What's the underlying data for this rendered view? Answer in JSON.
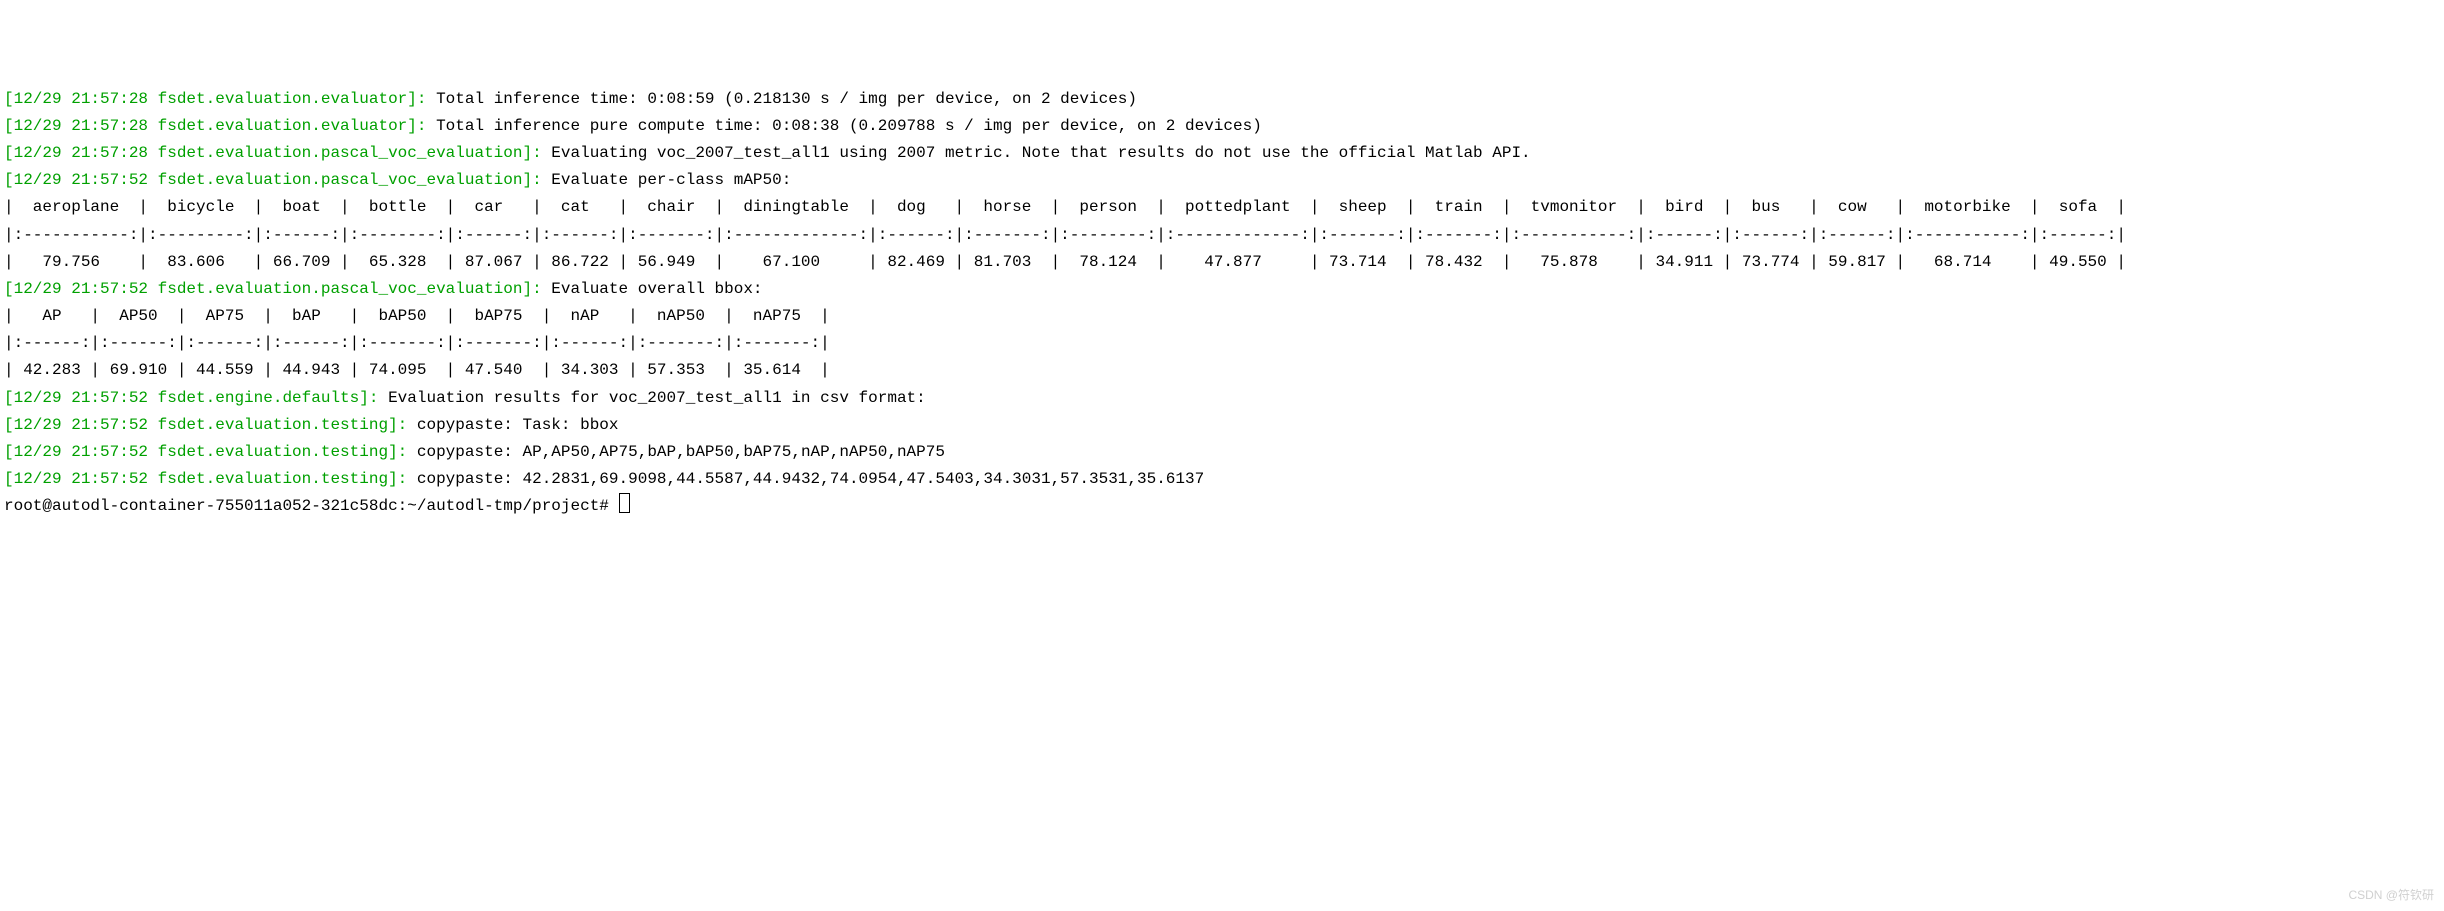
{
  "lines": [
    {
      "prefix": "[12/29 21:57:28 fsdet.evaluation.evaluator]: ",
      "body": "Total inference time: 0:08:59 (0.218130 s / img per device, on 2 devices)"
    },
    {
      "prefix": "[12/29 21:57:28 fsdet.evaluation.evaluator]: ",
      "body": "Total inference pure compute time: 0:08:38 (0.209788 s / img per device, on 2 devices)"
    },
    {
      "prefix": "[12/29 21:57:28 fsdet.evaluation.pascal_voc_evaluation]: ",
      "body": "Evaluating voc_2007_test_all1 using 2007 metric. Note that results do not use the official Matlab API."
    },
    {
      "prefix": "[12/29 21:57:52 fsdet.evaluation.pascal_voc_evaluation]: ",
      "body": "Evaluate per-class mAP50:"
    },
    {
      "prefix": "",
      "body": "|  aeroplane  |  bicycle  |  boat  |  bottle  |  car   |  cat   |  chair  |  diningtable  |  dog   |  horse  |  person  |  pottedplant  |  sheep  |  train  |  tvmonitor  |  bird  |  bus   |  cow   |  motorbike  |  sofa  |"
    },
    {
      "prefix": "",
      "body": "|:-----------:|:---------:|:------:|:--------:|:------:|:------:|:-------:|:-------------:|:------:|:-------:|:--------:|:-------------:|:-------:|:-------:|:-----------:|:------:|:------:|:------:|:-----------:|:------:|"
    },
    {
      "prefix": "",
      "body": "|   79.756    |  83.606   | 66.709 |  65.328  | 87.067 | 86.722 | 56.949  |    67.100     | 82.469 | 81.703  |  78.124  |    47.877     | 73.714  | 78.432  |   75.878    | 34.911 | 73.774 | 59.817 |   68.714    | 49.550 |"
    },
    {
      "prefix": "[12/29 21:57:52 fsdet.evaluation.pascal_voc_evaluation]: ",
      "body": "Evaluate overall bbox:"
    },
    {
      "prefix": "",
      "body": "|   AP   |  AP50  |  AP75  |  bAP   |  bAP50  |  bAP75  |  nAP   |  nAP50  |  nAP75  |"
    },
    {
      "prefix": "",
      "body": "|:------:|:------:|:------:|:------:|:-------:|:-------:|:------:|:-------:|:-------:|"
    },
    {
      "prefix": "",
      "body": "| 42.283 | 69.910 | 44.559 | 44.943 | 74.095  | 47.540  | 34.303 | 57.353  | 35.614  |"
    },
    {
      "prefix": "[12/29 21:57:52 fsdet.engine.defaults]: ",
      "body": "Evaluation results for voc_2007_test_all1 in csv format:"
    },
    {
      "prefix": "[12/29 21:57:52 fsdet.evaluation.testing]: ",
      "body": "copypaste: Task: bbox"
    },
    {
      "prefix": "[12/29 21:57:52 fsdet.evaluation.testing]: ",
      "body": "copypaste: AP,AP50,AP75,bAP,bAP50,bAP75,nAP,nAP50,nAP75"
    },
    {
      "prefix": "[12/29 21:57:52 fsdet.evaluation.testing]: ",
      "body": "copypaste: 42.2831,69.9098,44.5587,44.9432,74.0954,47.5403,34.3031,57.3531,35.6137"
    }
  ],
  "prompt": "root@autodl-container-755011a052-321c58dc:~/autodl-tmp/project# ",
  "watermark": "CSDN @符钦研"
}
